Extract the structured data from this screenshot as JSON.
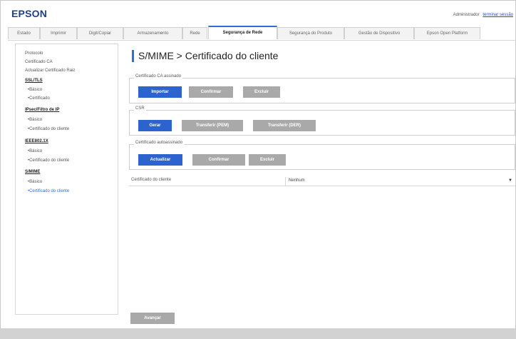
{
  "header": {
    "brand": "EPSON",
    "admin_label": "Administrador",
    "logout_label": "terminar sessão"
  },
  "tabs": [
    {
      "label": "Estado"
    },
    {
      "label": "Imprimir"
    },
    {
      "label": "Digit/Copiar"
    },
    {
      "label": "Armazenamento"
    },
    {
      "label": "Rede"
    },
    {
      "label": "Segurança de Rede"
    },
    {
      "label": "Segurança do Produto"
    },
    {
      "label": "Gestão de Dispositivo"
    },
    {
      "label": "Epson Open Platform"
    }
  ],
  "sidebar": {
    "items": [
      {
        "label": "Protocolo"
      },
      {
        "label": "Certificado CA"
      },
      {
        "label": "Actualizar Certificado Raiz"
      },
      {
        "label": "SSL/TLS"
      },
      {
        "label": "•Básico"
      },
      {
        "label": "•Certificado"
      },
      {
        "label": "IPsec/Filtro de IP"
      },
      {
        "label": "•Básico"
      },
      {
        "label": "•Certificado do cliente"
      },
      {
        "label": "IEEE802.1X"
      },
      {
        "label": "•Básico"
      },
      {
        "label": "•Certificado do cliente"
      },
      {
        "label": "S/MIME"
      },
      {
        "label": "•Básico"
      },
      {
        "label": "•Certificado do cliente"
      }
    ]
  },
  "main": {
    "title": "S/MIME  > Certificado do cliente",
    "ca_signed": {
      "legend": "Certificado CA assinado",
      "import_label": "Importar",
      "confirm_label": "Confirmar",
      "delete_label": "Excluir"
    },
    "csr": {
      "legend": "CSR",
      "generate_label": "Gerar",
      "transfer_pem_label": "Transferir (PEM)",
      "transfer_der_label": "Transferir (DER)"
    },
    "self_signed": {
      "legend": "Certificado autoassinado",
      "update_label": "Actualizar",
      "confirm_label": "Confirmar",
      "delete_label": "Excluir"
    },
    "client_cert": {
      "label": "Certificado do cliente",
      "value": "Nenhum"
    },
    "next_label": "Avançar"
  },
  "colors": {
    "accent": "#2c63cf",
    "disabled": "#a9a9a9",
    "brand": "#1e3f8f"
  }
}
